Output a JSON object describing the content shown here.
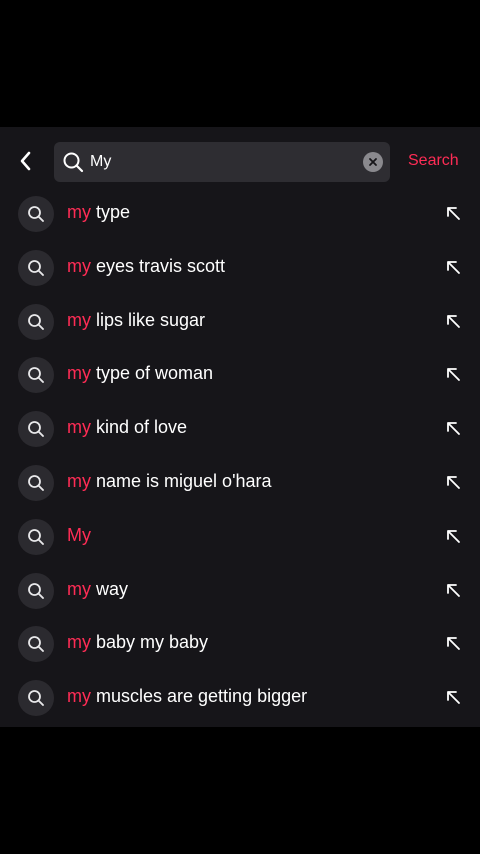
{
  "header": {
    "back_icon": "chevron-left-icon",
    "search_value": "My",
    "search_icon": "search-icon",
    "clear_icon": "clear-x-icon",
    "search_button": "Search"
  },
  "suggestions": [
    {
      "prefix": "my",
      "rest": " type"
    },
    {
      "prefix": "my",
      "rest": " eyes travis scott"
    },
    {
      "prefix": "my",
      "rest": " lips like sugar"
    },
    {
      "prefix": "my",
      "rest": " type of woman"
    },
    {
      "prefix": "my",
      "rest": " kind of love"
    },
    {
      "prefix": "my",
      "rest": " name is miguel o'hara"
    },
    {
      "prefix": "My",
      "rest": ""
    },
    {
      "prefix": "my",
      "rest": " way"
    },
    {
      "prefix": "my",
      "rest": " baby my baby"
    },
    {
      "prefix": "my",
      "rest": " muscles are getting bigger"
    }
  ],
  "colors": {
    "accent": "#fe2c55",
    "panel": "#161519",
    "input_bg": "#2e2d32",
    "text": "#ffffff"
  }
}
